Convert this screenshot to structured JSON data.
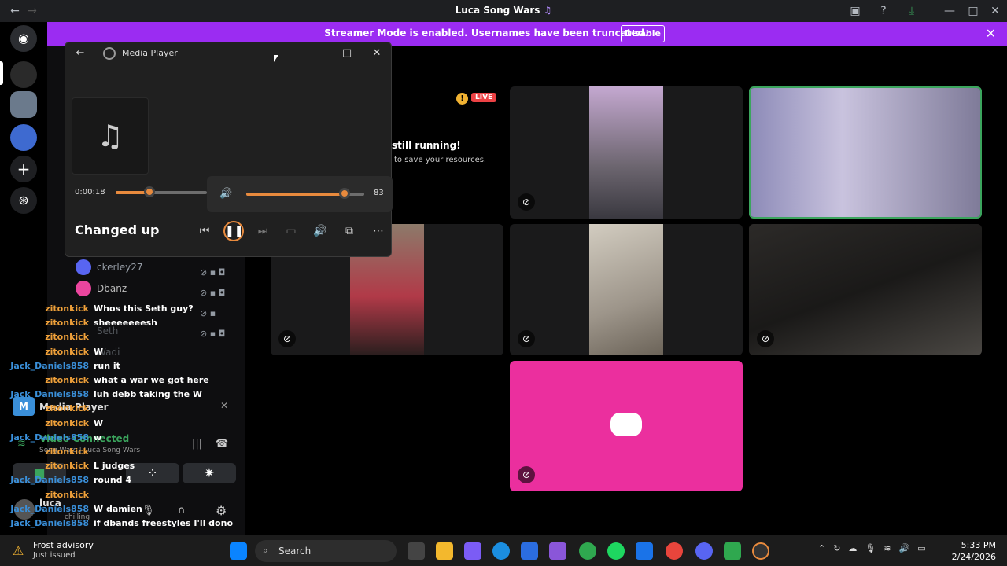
{
  "window": {
    "title": "Luca Song Wars"
  },
  "banner": {
    "text": "Streamer Mode is enabled. Usernames have been truncated.",
    "button": "Disable"
  },
  "colors": {
    "accent": "#e88a3d",
    "banner": "#9b2cf2",
    "live": "#ed4245",
    "discord_blurple": "#5865f2",
    "discord_pink": "#eb459e",
    "speaking_green": "#3ba55d",
    "chat_orange": "#f0a13a",
    "chat_blue": "#3a8fd9"
  },
  "media_player": {
    "title": "Media Player",
    "song": "Changed up",
    "elapsed": "0:00:18",
    "progress_fraction": 0.37,
    "volume": "83",
    "volume_fraction": 0.83,
    "icons": [
      "back-arrow-icon",
      "music-note-icon",
      "volume-icon",
      "previous-icon",
      "pause-icon",
      "next-icon",
      "caption-icon",
      "more-icon"
    ]
  },
  "stage": {
    "live_badge": "LIVE",
    "notice_title": "still running!",
    "notice_sub": "to save your resources."
  },
  "members": [
    "ckerley27",
    "Dbanz",
    "Seth",
    "Wadi"
  ],
  "chat": [
    {
      "user": "zitonkick",
      "msg": "Whos this Seth guy?"
    },
    {
      "user": "zitonkick",
      "msg": "sheeeeeeesh"
    },
    {
      "user": "zitonkick",
      "msg": ""
    },
    {
      "user": "zitonkick",
      "msg": "W"
    },
    {
      "user": "Jack_Daniels858",
      "msg": "run it"
    },
    {
      "user": "zitonkick",
      "msg": "what a war we got here"
    },
    {
      "user": "Jack_Daniels858",
      "msg": "luh debb taking the W"
    },
    {
      "user": "zitonkick",
      "msg": ""
    },
    {
      "user": "zitonkick",
      "msg": "W"
    },
    {
      "user": "Jack_Daniels858",
      "msg": "w"
    },
    {
      "user": "zitonkick",
      "msg": ""
    },
    {
      "user": "zitonkick",
      "msg": "L judges"
    },
    {
      "user": "Jack_Daniels858",
      "msg": "round 4"
    },
    {
      "user": "zitonkick",
      "msg": ""
    },
    {
      "user": "Jack_Daniels858",
      "msg": "W damien"
    },
    {
      "user": "Jack_Daniels858",
      "msg": "if dbands freestyles I'll dono"
    }
  ],
  "voice_panel": {
    "activity": "Media Player",
    "status": "Video Connected",
    "channel": "Song Wars | Luca Song Wars",
    "user": "luca",
    "user_status": "chilling"
  },
  "taskbar": {
    "weather_title": "Frost advisory",
    "weather_sub": "Just issued",
    "search": "Search",
    "time": "5:33 PM",
    "date": "2/24/2026"
  }
}
